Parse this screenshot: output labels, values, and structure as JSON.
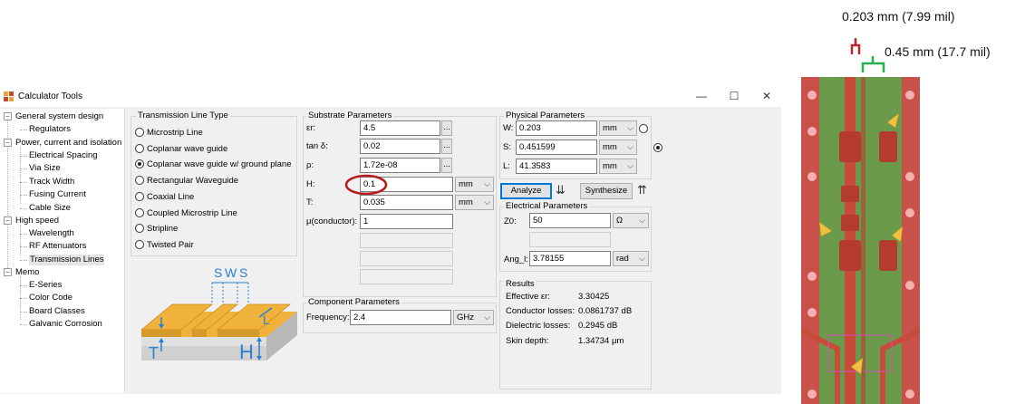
{
  "annotations": {
    "top_dimension": "0.203 mm (7.99 mil)",
    "right_dimension": "0.45 mm (17.7 mil)"
  },
  "window": {
    "title": "Calculator Tools",
    "minimize": "—",
    "maximize": "☐",
    "close": "✕"
  },
  "tree": {
    "groups": [
      {
        "label": "General system design",
        "children": [
          "Regulators"
        ]
      },
      {
        "label": "Power, current and isolation",
        "children": [
          "Electrical Spacing",
          "Via Size",
          "Track Width",
          "Fusing Current",
          "Cable Size"
        ]
      },
      {
        "label": "High speed",
        "children": [
          "Wavelength",
          "RF Attenuators",
          "Transmission Lines"
        ]
      },
      {
        "label": "Memo",
        "children": [
          "E-Series",
          "Color Code",
          "Board Classes",
          "Galvanic Corrosion"
        ]
      }
    ],
    "selected": "Transmission Lines"
  },
  "tl_type": {
    "title": "Transmission Line Type",
    "options": [
      "Microstrip Line",
      "Coplanar wave guide",
      "Coplanar wave guide w/ ground plane",
      "Rectangular Waveguide",
      "Coaxial Line",
      "Coupled Microstrip Line",
      "Stripline",
      "Twisted Pair"
    ],
    "selected_index": 2
  },
  "diagram": {
    "s1": "S",
    "w": "W",
    "s2": "S",
    "t": "T",
    "h": "H",
    "l": "L"
  },
  "substrate": {
    "title": "Substrate Parameters",
    "er_label": "εr:",
    "er_value": "4.5",
    "tand_label": "tan δ:",
    "tand_value": "0.02",
    "rho_label": "ρ:",
    "rho_value": "1.72e-08",
    "h_label": "H:",
    "h_value": "0.1",
    "h_unit": "mm",
    "t_label": "T:",
    "t_value": "0.035",
    "t_unit": "mm",
    "mu_label": "μ(conductor):",
    "mu_value": "1",
    "dots": "..."
  },
  "component": {
    "title": "Component Parameters",
    "freq_label": "Frequency:",
    "freq_value": "2.4",
    "freq_unit": "GHz"
  },
  "physical": {
    "title": "Physical Parameters",
    "w_label": "W:",
    "w_value": "0.203",
    "w_unit": "mm",
    "s_label": "S:",
    "s_value": "0.451599",
    "s_unit": "mm",
    "l_label": "L:",
    "l_value": "41.3583",
    "l_unit": "mm",
    "analyze": "Analyze",
    "synthesize": "Synthesize"
  },
  "electrical": {
    "title": "Electrical Parameters",
    "z0_label": "Z0:",
    "z0_value": "50",
    "z0_unit": "Ω",
    "angl_label": "Ang_l:",
    "angl_value": "3.78155",
    "angl_unit": "rad"
  },
  "results": {
    "title": "Results",
    "rows": [
      {
        "label": "Effective εr:",
        "value": "3.30425"
      },
      {
        "label": "Conductor losses:",
        "value": "0.0861737 dB"
      },
      {
        "label": "Dielectric losses:",
        "value": "0.2945 dB"
      },
      {
        "label": "Skin depth:",
        "value": "1.34734 μm"
      }
    ]
  },
  "colors": {
    "annotation_red": "#c0272d",
    "annotation_green": "#22b14c",
    "pcb_green": "#6a9a4a",
    "pcb_trace": "#c74a3a",
    "highlight_circle": "#b71c1c",
    "focus_blue": "#0078d7"
  }
}
